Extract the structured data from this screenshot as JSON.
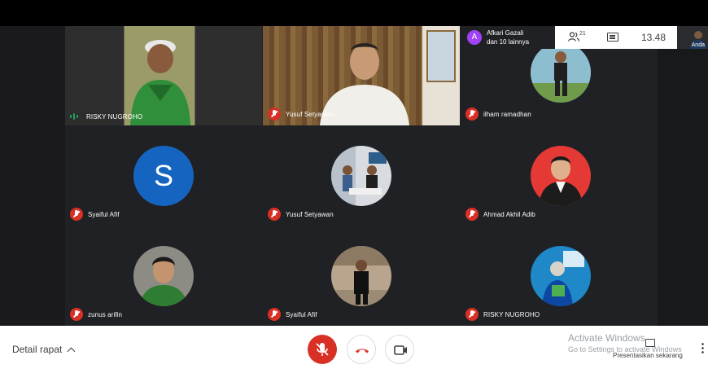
{
  "clock": "13.48",
  "participant_count": "21",
  "notification": {
    "avatar_letter": "A",
    "line1": "Afkari Gazali",
    "line2": "dan 10 lainnya"
  },
  "self_label": "Anda",
  "tiles": [
    {
      "name": "RISKY NUGROHO",
      "status": "speaking"
    },
    {
      "name": "Yusuf Setyawan",
      "status": "muted"
    },
    {
      "name": "ilham ramadhan",
      "status": "muted"
    },
    {
      "name": "Syaiful Afif",
      "status": "muted",
      "avatar_letter": "S"
    },
    {
      "name": "Yusuf Setyawan",
      "status": "muted"
    },
    {
      "name": "Ahmad Akhil Adib",
      "status": "muted"
    },
    {
      "name": "zunus arifin",
      "status": "muted"
    },
    {
      "name": "Syaiful Afif",
      "status": "muted"
    },
    {
      "name": "RISKY NUGROHO",
      "status": "muted"
    }
  ],
  "bottom": {
    "details_label": "Detail rapat",
    "present_label": "Presentasikan sekarang",
    "watermark_line1": "Activate Windows",
    "watermark_line2": "Go to Settings to activate Windows"
  },
  "colors": {
    "mute_red": "#d93025",
    "avatar_blue": "#1565c0",
    "notif_avatar": "#a142f4",
    "talking_green": "#1ea362"
  },
  "icons": [
    "microphone-off-icon",
    "hang-up-icon",
    "camera-icon",
    "people-icon",
    "chat-icon",
    "present-icon",
    "more-icon",
    "chevron-up-icon"
  ]
}
